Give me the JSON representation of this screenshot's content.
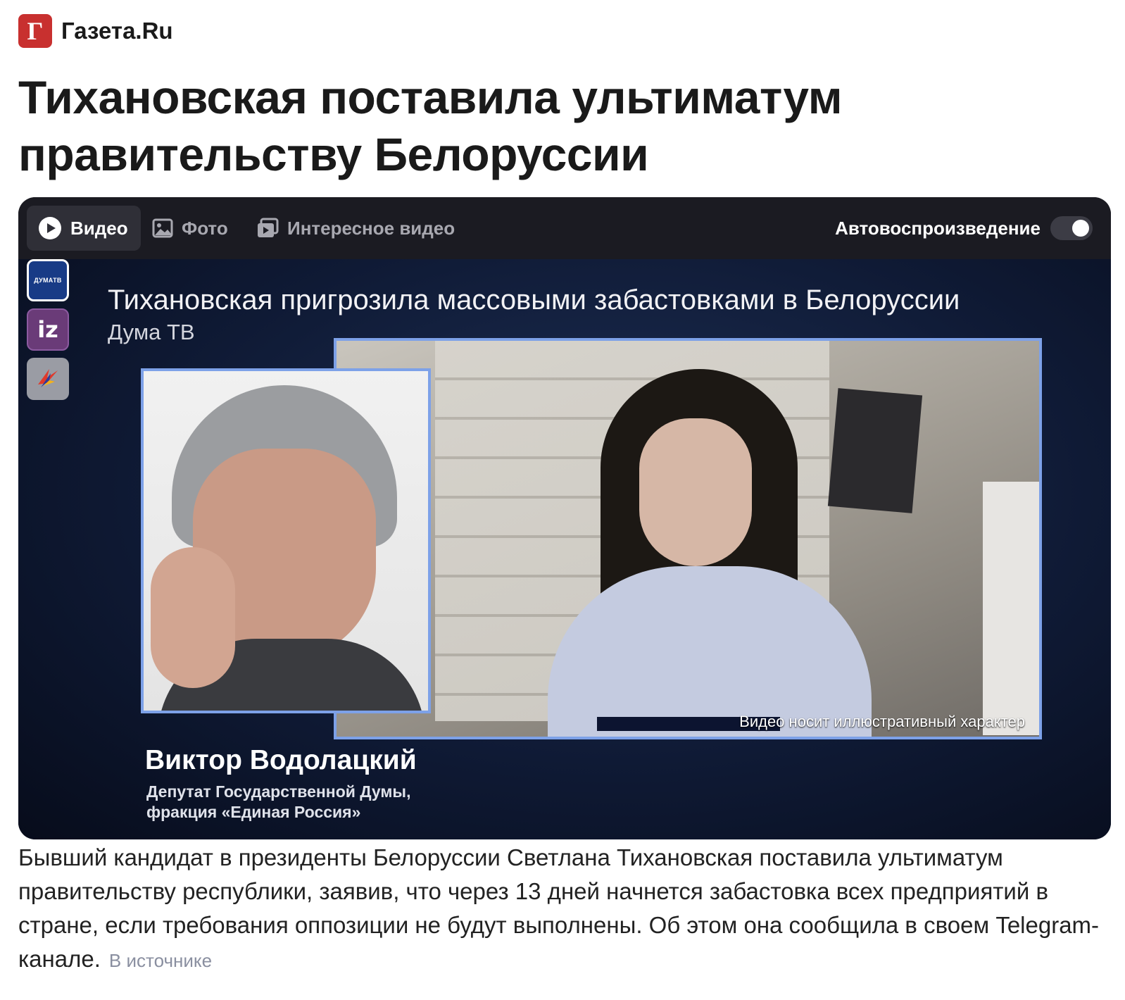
{
  "source": {
    "logo_letter": "Г",
    "name": "Газета.Ru",
    "brand_color": "#c8302f"
  },
  "headline": "Тихановская поставила ультиматум правительству Белоруссии",
  "player": {
    "tabs": [
      {
        "label": "Видео",
        "icon": "play-circle-icon",
        "active": true
      },
      {
        "label": "Фото",
        "icon": "image-icon",
        "active": false
      },
      {
        "label": "Интересное видео",
        "icon": "video-stack-icon",
        "active": false
      }
    ],
    "autoplay_label": "Автовоспроизведение",
    "autoplay_on": true,
    "channels": [
      {
        "label": "ДУМАТВ",
        "active": true
      },
      {
        "label": "iz",
        "active": false
      },
      {
        "label": "",
        "icon": "bird-logo-icon",
        "active": false
      }
    ],
    "video": {
      "title": "Тихановская пригрозила массовыми забастовками в Белоруссии",
      "channel": "Дума ТВ",
      "note": "Видео носит иллюстративный характер",
      "speaker_name": "Виктор Водолацкий",
      "speaker_role_line1": "Депутат Государственной Думы,",
      "speaker_role_line2": "фракция «Единая Россия»"
    }
  },
  "lead": {
    "text": "Бывший кандидат в президенты Белоруссии Светлана Тихановская поставила ультиматум правительству республики, заявив, что через 13 дней начнется забастовка всех предприятий в стране, если требования оппозиции не будут выполнены. Об этом она сообщила в своем Telegram-канале.",
    "source_link": "В источнике"
  }
}
